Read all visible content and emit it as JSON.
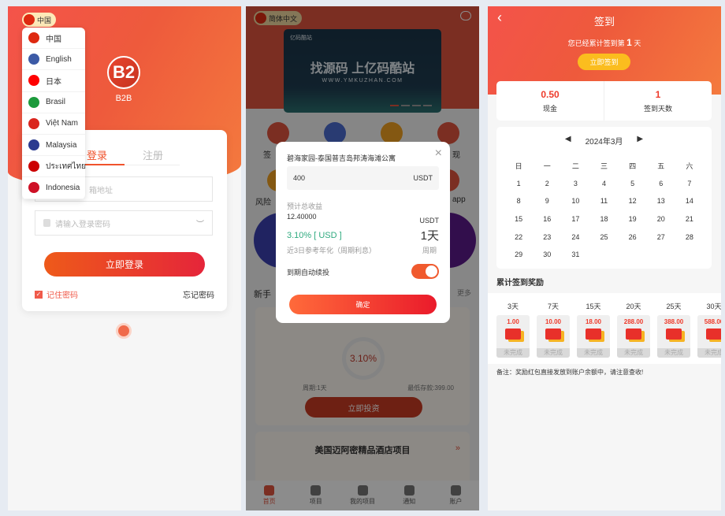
{
  "login": {
    "lang_current": "中国",
    "languages": [
      {
        "label": "中国",
        "flag": "#de2910"
      },
      {
        "label": "English",
        "flag": "#3c5aa6"
      },
      {
        "label": "日本",
        "flag": "#ff0000"
      },
      {
        "label": "Brasil",
        "flag": "#1c9a3c"
      },
      {
        "label": "Việt Nam",
        "flag": "#da251d"
      },
      {
        "label": "Malaysia",
        "flag": "#2b3a8f"
      },
      {
        "label": "ประเทศไทย",
        "flag": "#cc0001"
      },
      {
        "label": "Indonesia",
        "flag": "#ce1126"
      }
    ],
    "brand": "B2B",
    "logo_letter": "B2",
    "tab_login": "登录",
    "tab_register": "注册",
    "email_placeholder": "箱地址",
    "password_placeholder": "请输入登录密码",
    "login_button": "立即登录",
    "remember": "记住密码",
    "forgot": "忘记密码"
  },
  "home": {
    "lang": "简体中文",
    "banner_title": "找源码 上亿码酷站",
    "banner_url": "WWW.YMKUZHAN.COM",
    "banner_logo": "亿码酷站",
    "icon_fragments": [
      "签",
      "现",
      "风险",
      "app"
    ],
    "section_title": "新手",
    "more": "更多",
    "product1": {
      "rate": "3.10%",
      "period": "周期:1天",
      "min": "最低存款:399.00",
      "button": "立即投资"
    },
    "product2": {
      "title": "美国迈阿密精品酒店项目"
    },
    "nav": [
      "首页",
      "项目",
      "我的项目",
      "通知",
      "账户"
    ],
    "modal": {
      "title": "碧海家园-泰国普吉岛邦涛海滩公寓",
      "amount": "400",
      "currency": "USDT",
      "est_label": "预计总收益",
      "est_value": "12.40000",
      "est_unit": "USDT",
      "rate": "3.10% [ USD ]",
      "rate_note": "近3日参考年化（周期利息）",
      "period_value": "1天",
      "period_label": "周期",
      "auto_renew": "到期自动续投",
      "auto_renew_on": true,
      "confirm": "确定"
    }
  },
  "checkin": {
    "title": "签到",
    "summary_prefix": "您已经累计签到第",
    "summary_days": "1",
    "summary_suffix": "天",
    "checkin_button": "立即签到",
    "cash_value": "0.50",
    "cash_label": "现金",
    "days_value": "1",
    "days_label": "签到天数",
    "month": "2024年3月",
    "weekdays": [
      "日",
      "一",
      "二",
      "三",
      "四",
      "五",
      "六"
    ],
    "days": [
      "1",
      "2",
      "3",
      "4",
      "5",
      "6",
      "7",
      "8",
      "9",
      "10",
      "11",
      "12",
      "13",
      "14",
      "15",
      "16",
      "17",
      "18",
      "19",
      "20",
      "21",
      "22",
      "23",
      "24",
      "25",
      "26",
      "27",
      "28",
      "29",
      "30",
      "31"
    ],
    "rewards_title": "累计签到奖励",
    "rewards": [
      {
        "day": "3天",
        "amount": "1.00",
        "status": "未完成"
      },
      {
        "day": "7天",
        "amount": "10.00",
        "status": "未完成"
      },
      {
        "day": "15天",
        "amount": "18.00",
        "status": "未完成"
      },
      {
        "day": "20天",
        "amount": "288.00",
        "status": "未完成"
      },
      {
        "day": "25天",
        "amount": "388.00",
        "status": "未完成"
      },
      {
        "day": "30天",
        "amount": "588.00",
        "status": "未完成"
      }
    ],
    "note": "备注：奖励红包直接发放到账户余额中，请注意查收!"
  }
}
